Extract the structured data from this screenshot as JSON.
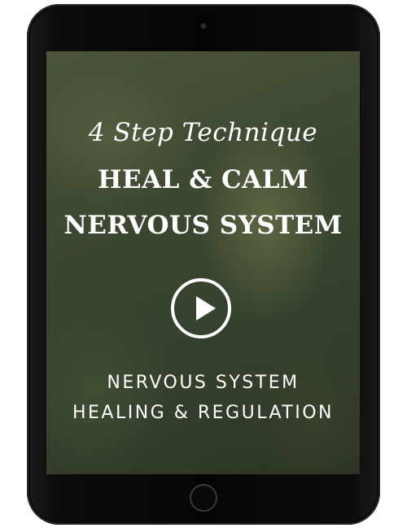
{
  "video": {
    "title_italic": "4 Step Technique",
    "title_line1": "HEAL & CALM",
    "title_line2": "NERVOUS SYSTEM",
    "play_icon": "play-icon",
    "subtitle_line1": "NERVOUS SYSTEM",
    "subtitle_line2": "HEALING & REGULATION"
  },
  "device": {
    "frame_color": "#050505",
    "accent_color": "#ffffff"
  }
}
